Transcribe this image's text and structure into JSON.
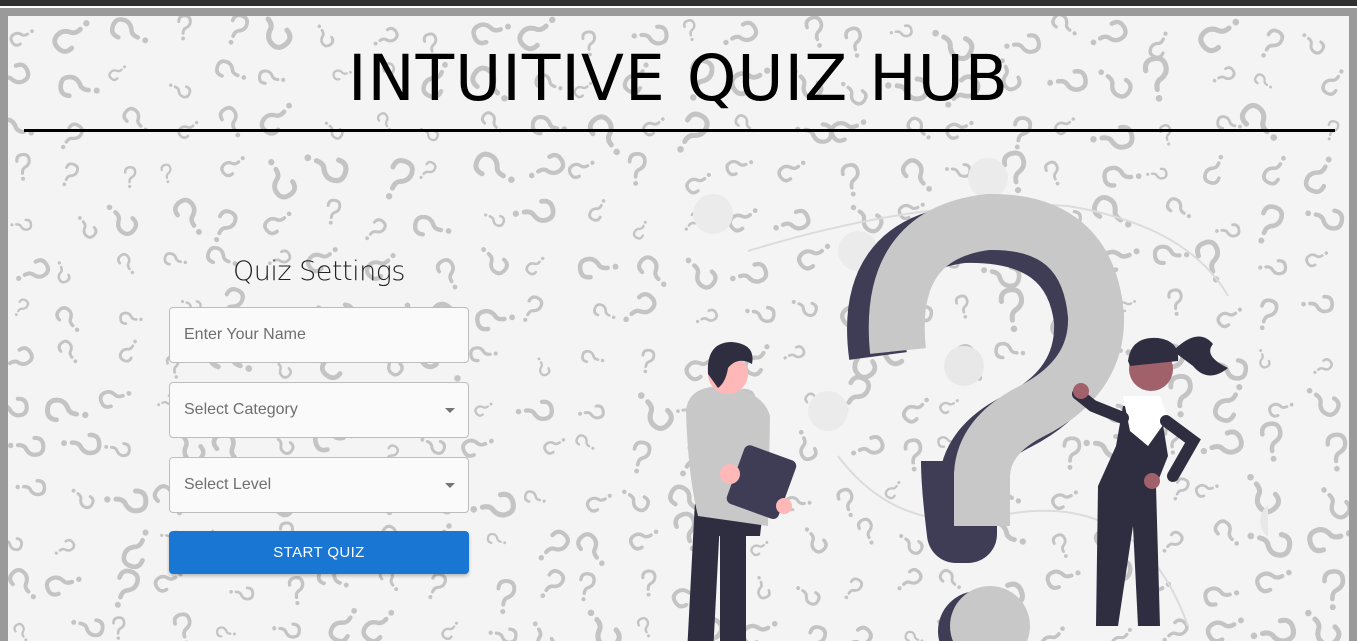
{
  "header": {
    "title": "INTUITIVE QUIZ HUB"
  },
  "settings": {
    "title": "Quiz Settings",
    "name_placeholder": "Enter Your Name",
    "category_label": "Select Category",
    "level_label": "Select Level",
    "start_label": "START QUIZ"
  },
  "colors": {
    "accent": "#1976d2",
    "frame": "#9a9a9a",
    "background": "#f4f4f4",
    "pattern_mark": "#c4c4c4"
  },
  "illustration": {
    "name": "question-mark-people-illustration"
  }
}
